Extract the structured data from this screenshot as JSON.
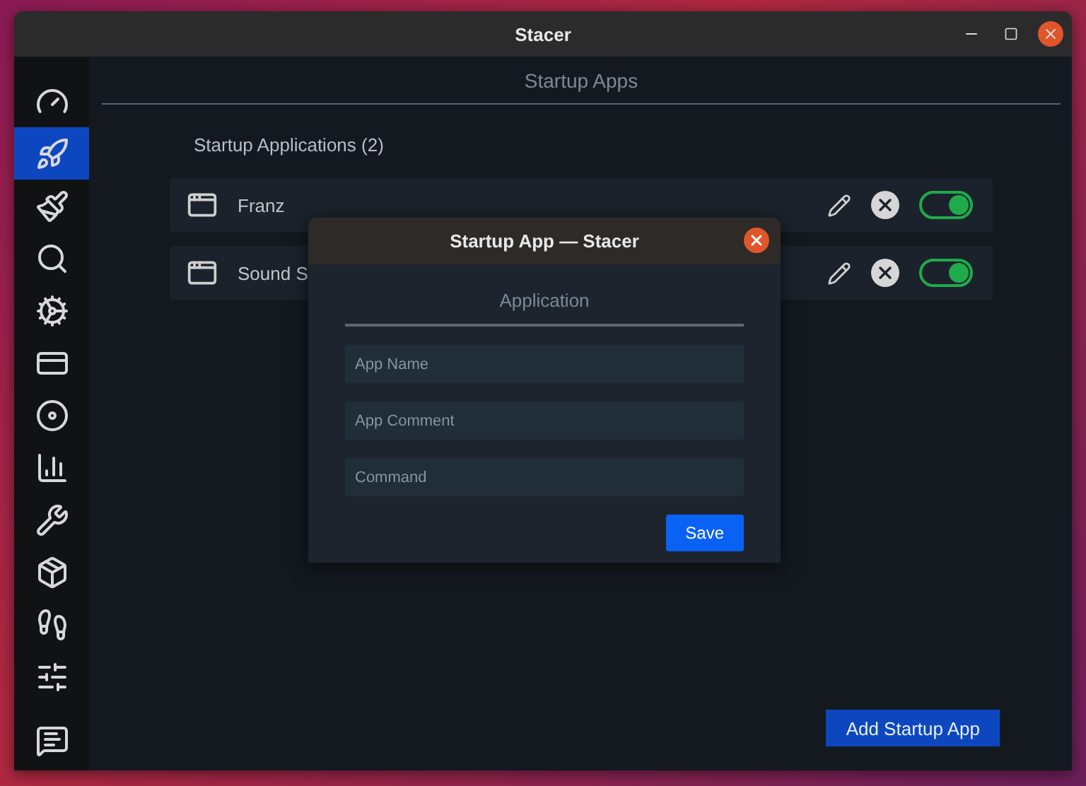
{
  "window": {
    "title": "Stacer"
  },
  "sidebar": {
    "items": [
      {
        "selected": false
      },
      {
        "selected": true
      },
      {
        "selected": false
      },
      {
        "selected": false
      },
      {
        "selected": false
      },
      {
        "selected": false
      },
      {
        "selected": false
      },
      {
        "selected": false
      },
      {
        "selected": false
      },
      {
        "selected": false
      },
      {
        "selected": false
      },
      {
        "selected": false
      },
      {
        "selected": false
      }
    ]
  },
  "page": {
    "title": "Startup Apps",
    "heading": "Startup Applications (2)",
    "apps": [
      {
        "name": "Franz",
        "on": true
      },
      {
        "name": "Sound S",
        "on": true
      }
    ],
    "add_button": "Add Startup App"
  },
  "dialog": {
    "title": "Startup App — Stacer",
    "section": "Application",
    "fields": [
      {
        "placeholder": "App Name"
      },
      {
        "placeholder": "App Comment"
      },
      {
        "placeholder": "Command"
      }
    ],
    "save_button": "Save"
  }
}
